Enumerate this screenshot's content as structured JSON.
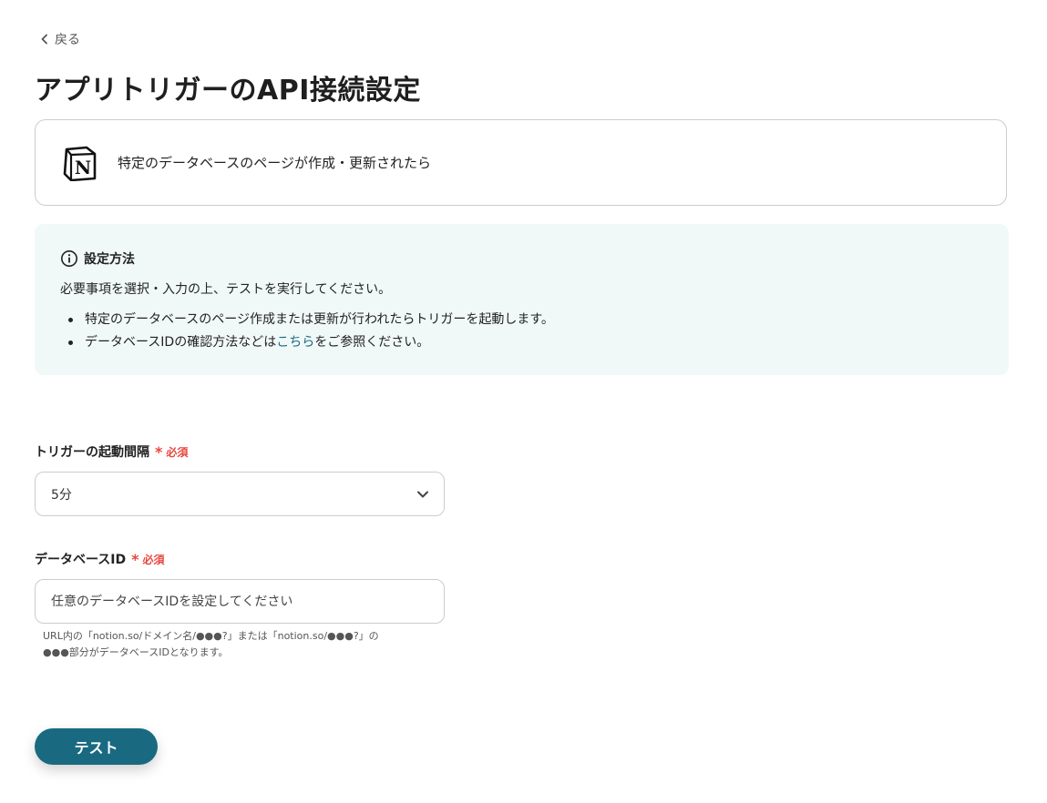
{
  "nav": {
    "back_label": "戻る",
    "back_icon": "chevron-left-icon"
  },
  "page_title": "アプリトリガーのAPI接続設定",
  "app_card": {
    "app_icon": "notion-logo",
    "trigger_text": "特定のデータベースのページが作成・更新されたら"
  },
  "info_box": {
    "icon": "info-icon",
    "heading": "設定方法",
    "description": "必要事項を選択・入力の上、テストを実行してください。",
    "bullets": [
      {
        "text": "特定のデータベースのページ作成または更新が行われたらトリガーを起動します。"
      },
      {
        "text_before": "データベースIDの確認方法などは",
        "link_text": "こちら",
        "text_after": "をご参照ください。"
      }
    ],
    "background_color": "#f1f8f8",
    "link_color": "#1d6b80"
  },
  "form": {
    "interval": {
      "label": "トリガーの起動間隔",
      "required_star": "*",
      "required_text": "必須",
      "selected_value": "5分",
      "dropdown_icon": "chevron-down-icon"
    },
    "database_id": {
      "label": "データベースID",
      "required_star": "*",
      "required_text": "必須",
      "value": "",
      "placeholder": "任意のデータベースIDを設定してください",
      "help_line1": "URL内の「notion.so/ドメイン名/●●●?」または「notion.so/●●●?」の",
      "help_line2": "●●●部分がデータベースIDとなります。"
    },
    "required_color": "#e8473f"
  },
  "actions": {
    "test_label": "テスト",
    "button_color": "#196a80"
  }
}
